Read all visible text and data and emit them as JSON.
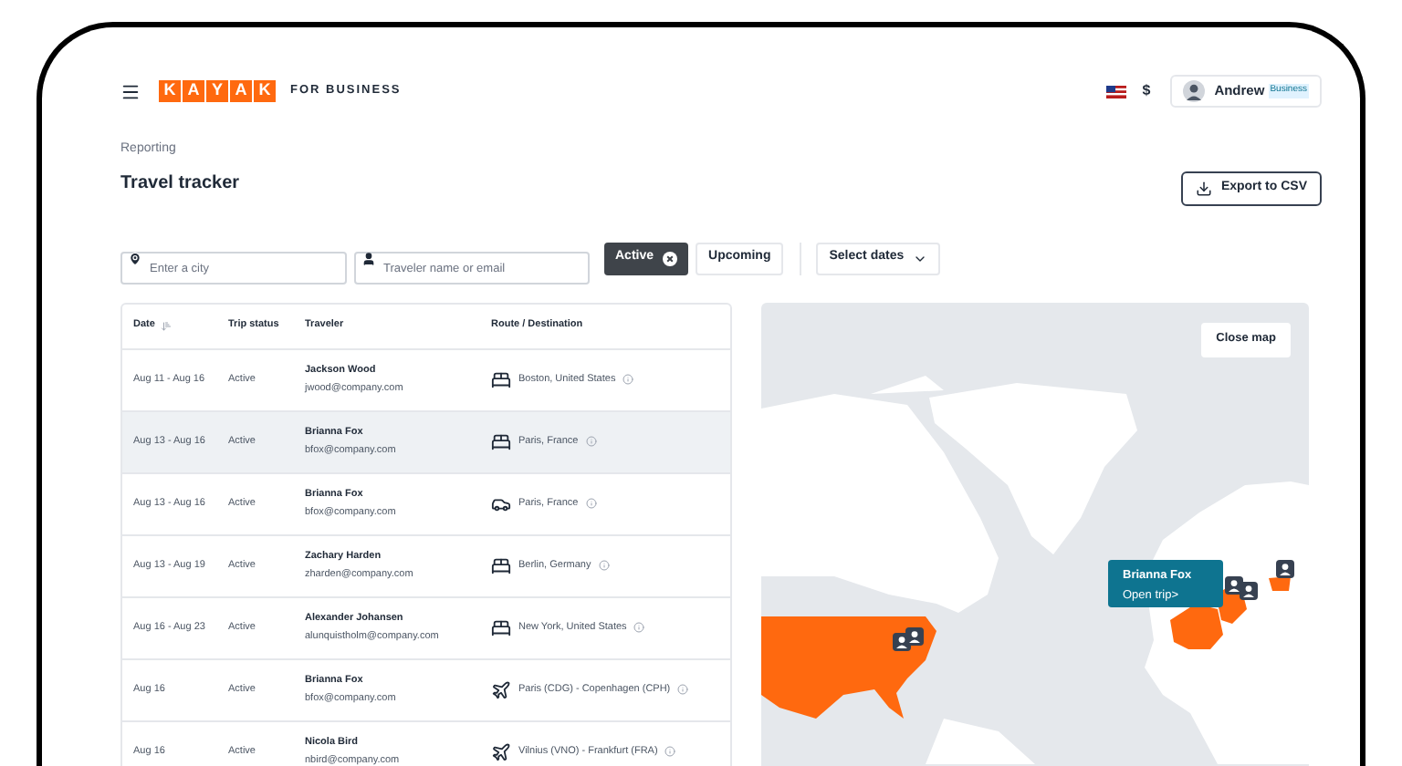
{
  "header": {
    "logo_letters": [
      "K",
      "A",
      "Y",
      "A",
      "K"
    ],
    "logo_suffix": "FOR BUSINESS",
    "currency": "$",
    "user": {
      "name": "Andrew",
      "badge": "Business"
    }
  },
  "page": {
    "breadcrumb": "Reporting",
    "title": "Travel tracker",
    "export_button": "Export to CSV"
  },
  "filters": {
    "city": {
      "placeholder": "Enter a city"
    },
    "traveler": {
      "placeholder": "Traveler name or email"
    },
    "chips": [
      {
        "label": "Active",
        "selected": true
      },
      {
        "label": "Upcoming",
        "selected": false
      }
    ],
    "dates": "Select dates"
  },
  "table": {
    "columns": [
      "Date",
      "Trip status",
      "Traveler",
      "Route / Destination"
    ],
    "rows": [
      {
        "date": "Aug 11 - Aug 16",
        "status": "Active",
        "name": "Jackson Wood",
        "email": "jwood@company.com",
        "kind": "hotel",
        "route": "Boston, United States",
        "selected": false
      },
      {
        "date": "Aug 13 - Aug 16",
        "status": "Active",
        "name": "Brianna Fox",
        "email": "bfox@company.com",
        "kind": "hotel",
        "route": "Paris, France",
        "selected": true
      },
      {
        "date": "Aug 13 - Aug 16",
        "status": "Active",
        "name": "Brianna Fox",
        "email": "bfox@company.com",
        "kind": "car",
        "route": "Paris, France",
        "selected": false
      },
      {
        "date": "Aug 13 - Aug 19",
        "status": "Active",
        "name": "Zachary Harden",
        "email": "zharden@company.com",
        "kind": "hotel",
        "route": "Berlin, Germany",
        "selected": false
      },
      {
        "date": "Aug 16 - Aug 23",
        "status": "Active",
        "name": "Alexander Johansen",
        "email": "alunquistholm@company.com",
        "kind": "hotel",
        "route": "New York, United States",
        "selected": false
      },
      {
        "date": "Aug 16",
        "status": "Active",
        "name": "Brianna Fox",
        "email": "bfox@company.com",
        "kind": "flight",
        "route": "Paris (CDG) - Copenhagen (CPH)",
        "selected": false
      },
      {
        "date": "Aug 16",
        "status": "Active",
        "name": "Nicola Bird",
        "email": "nbird@company.com",
        "kind": "flight",
        "route": "Vilnius (VNO) - Frankfurt (FRA)",
        "selected": false
      }
    ]
  },
  "map": {
    "close_button": "Close map",
    "popup": {
      "name": "Brianna Fox",
      "link": "Open trip>"
    }
  }
}
